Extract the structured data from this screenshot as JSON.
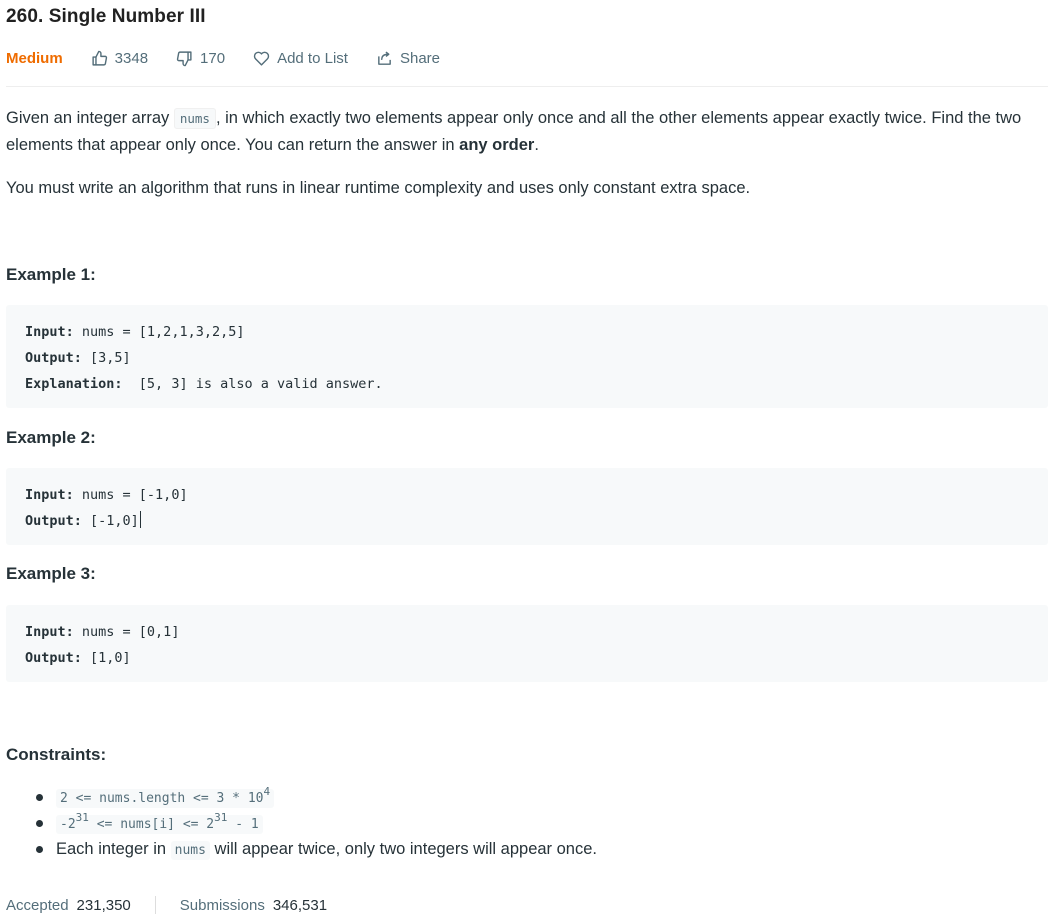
{
  "problem": {
    "title": "260. Single Number III",
    "difficulty": "Medium",
    "likes": "3348",
    "dislikes": "170",
    "add_to_list": "Add to List",
    "share": "Share"
  },
  "description": {
    "p1_part1": "Given an integer array ",
    "p1_code": "nums",
    "p1_part2": ", in which exactly two elements appear only once and all the other elements appear exactly twice. Find the two elements that appear only once. You can return the answer in ",
    "p1_bold": "any order",
    "p1_part3": ".",
    "p2": "You must write an algorithm that runs in linear runtime complexity and uses only constant extra space."
  },
  "examples": [
    {
      "heading": "Example 1:",
      "input_label": "Input:",
      "input": " nums = [1,2,1,3,2,5]",
      "output_label": "Output:",
      "output": " [3,5]",
      "explanation_label": "Explanation:",
      "explanation": "  [5, 3] is also a valid answer."
    },
    {
      "heading": "Example 2:",
      "input_label": "Input:",
      "input": " nums = [-1,0]",
      "output_label": "Output:",
      "output": " [-1,0]"
    },
    {
      "heading": "Example 3:",
      "input_label": "Input:",
      "input": " nums = [0,1]",
      "output_label": "Output:",
      "output": " [1,0]"
    }
  ],
  "constraints": {
    "heading": "Constraints:",
    "c1_code_a": "2 <= nums.length <= 3 * 10",
    "c1_sup": "4",
    "c2_code_a": "-2",
    "c2_sup_a": "31",
    "c2_code_b": " <= nums[i] <= 2",
    "c2_sup_b": "31",
    "c2_code_c": " - 1",
    "c3_part1": "Each integer in ",
    "c3_code": "nums",
    "c3_part2": " will appear twice, only two integers will appear once."
  },
  "stats": {
    "accepted_label": "Accepted",
    "accepted_value": "231,350",
    "submissions_label": "Submissions",
    "submissions_value": "346,531"
  },
  "colors": {
    "difficulty_medium": "#ef6c00",
    "meta_text": "#546e7a",
    "code_bg": "#f7f9fa"
  }
}
